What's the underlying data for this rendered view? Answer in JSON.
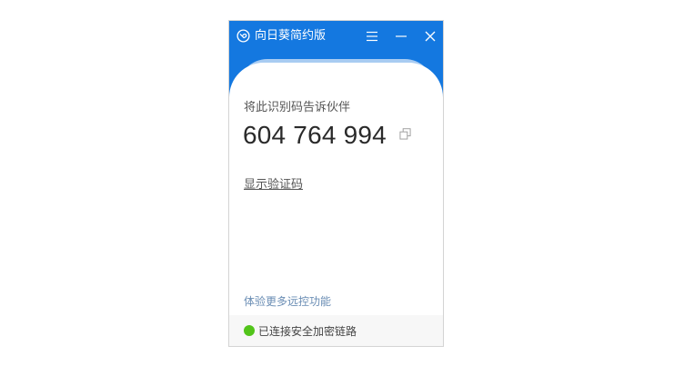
{
  "app": {
    "title": "向日葵简约版",
    "logo_icon": "sunflower-logo-icon",
    "accent_color": "#1478e0"
  },
  "titlebar": {
    "menu_icon": "menu-icon",
    "minimize_icon": "minimize-icon",
    "close_icon": "close-icon"
  },
  "main": {
    "share_label": "将此识别码告诉伙伴",
    "device_code": "604 764 994",
    "copy_icon": "copy-icon",
    "show_code_link": "显示验证码",
    "more_features_link": "体验更多远控功能"
  },
  "status": {
    "text": "已连接安全加密链路",
    "color": "#52c41a"
  }
}
